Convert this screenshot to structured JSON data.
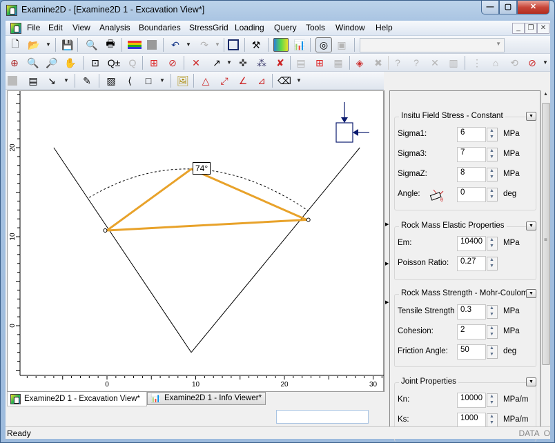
{
  "window": {
    "title": "Examine2D - [Examine2D 1 - Excavation View*]",
    "controls": {
      "minimize": "—",
      "maximize": "▢",
      "close": "✕"
    }
  },
  "menubar": {
    "items": [
      "File",
      "Edit",
      "View",
      "Analysis",
      "Boundaries",
      "StressGrid",
      "Loading",
      "Query",
      "Tools",
      "Window",
      "Help"
    ],
    "mdi_controls": {
      "minimize": "_",
      "restore": "❐",
      "close": "✕"
    }
  },
  "toolbar1": {
    "icons": [
      "new-file-icon",
      "open-folder-icon",
      "save-icon",
      "print-preview-icon",
      "print-icon",
      "contours-icon",
      "stop-icon",
      "undo-icon",
      "redo-icon",
      "split-view-icon",
      "compute-icon",
      "interpret-icon",
      "info-viewer-icon",
      "dial-icon",
      "display-options-icon"
    ],
    "combo_value": ""
  },
  "toolbar2": {
    "icons": [
      "zoom-all-icon",
      "zoom-in-icon",
      "zoom-out-icon",
      "pan-icon",
      "zoom-window-icon",
      "zoom-plus-minus-icon",
      "zoom-previous-icon",
      "add-excavation-icon",
      "delete-boundary-icon",
      "delete-vertex-icon",
      "add-vertex-icon",
      "move-vertex-icon",
      "snap-icon",
      "delete-snap-icon",
      "text-box-icon",
      "add-grid-icon",
      "delete-grid-icon",
      "add-query-line-icon",
      "delete-query-line-icon",
      "query-point-icon",
      "add-query-point-icon",
      "delete-query-point-icon",
      "graph-query-icon",
      "mirror-icon",
      "tunnel-shape-icon",
      "rotate-icon",
      "no-boundary-icon"
    ]
  },
  "toolbar3": {
    "icons": [
      "layer-icon",
      "notes-icon",
      "arrow-icon",
      "pencil-icon",
      "hatch-icon",
      "polyline-icon",
      "rectangle-icon",
      "image-icon",
      "angle-icon",
      "dimension-icon",
      "ruler-icon",
      "vertical-dimension-icon",
      "eraser-icon"
    ]
  },
  "view": {
    "angle_label": "74°",
    "x_ticks": [
      "0",
      "10",
      "20",
      "30"
    ],
    "y_ticks": [
      "0",
      "10",
      "20"
    ],
    "geometry_units": {
      "boundary_left": [
        [
          -6,
          20
        ],
        [
          9.5,
          -3
        ]
      ],
      "boundary_right": [
        [
          9.5,
          -3
        ],
        [
          28.5,
          20
        ]
      ],
      "wedge": [
        [
          0,
          10.7
        ],
        [
          9.5,
          17.6
        ],
        [
          22.5,
          11.9
        ]
      ],
      "vertices": [
        [
          -0.2,
          10.7
        ],
        [
          22.7,
          11.9
        ]
      ],
      "stress_colors": {
        "wedge": "#e8a22a",
        "arrows": "#0a1a6e"
      }
    }
  },
  "panel": {
    "groups": [
      {
        "title": "Insitu Field Stress - Constant",
        "fields": [
          {
            "label": "Sigma1:",
            "value": "6",
            "unit": "MPa"
          },
          {
            "label": "Sigma3:",
            "value": "7",
            "unit": "MPa"
          },
          {
            "label": "SigmaZ:",
            "value": "8",
            "unit": "MPa"
          },
          {
            "label": "Angle:",
            "value": "0",
            "unit": "deg"
          }
        ]
      },
      {
        "title": "Rock Mass Elastic Properties",
        "fields": [
          {
            "label": "Em:",
            "value": "10400",
            "unit": "MPa"
          },
          {
            "label": "Poisson Ratio:",
            "value": "0.27",
            "unit": ""
          }
        ]
      },
      {
        "title": "Rock Mass Strength - Mohr-Coulomb",
        "fields": [
          {
            "label": "Tensile Strength",
            "value": "0.3",
            "unit": "MPa"
          },
          {
            "label": "Cohesion:",
            "value": "2",
            "unit": "MPa"
          },
          {
            "label": "Friction Angle:",
            "value": "50",
            "unit": "deg"
          }
        ]
      },
      {
        "title": "Joint Properties",
        "fields": [
          {
            "label": "Kn:",
            "value": "10000",
            "unit": "MPa/m"
          },
          {
            "label": "Ks:",
            "value": "1000",
            "unit": "MPa/m"
          }
        ]
      }
    ]
  },
  "tabs": [
    {
      "label": "Examine2D 1 - Excavation View*",
      "active": true
    },
    {
      "label": "Examine2D 1 - Info Viewer*",
      "active": false
    }
  ],
  "statusbar": {
    "left": "Ready",
    "right": "DATA  O"
  }
}
